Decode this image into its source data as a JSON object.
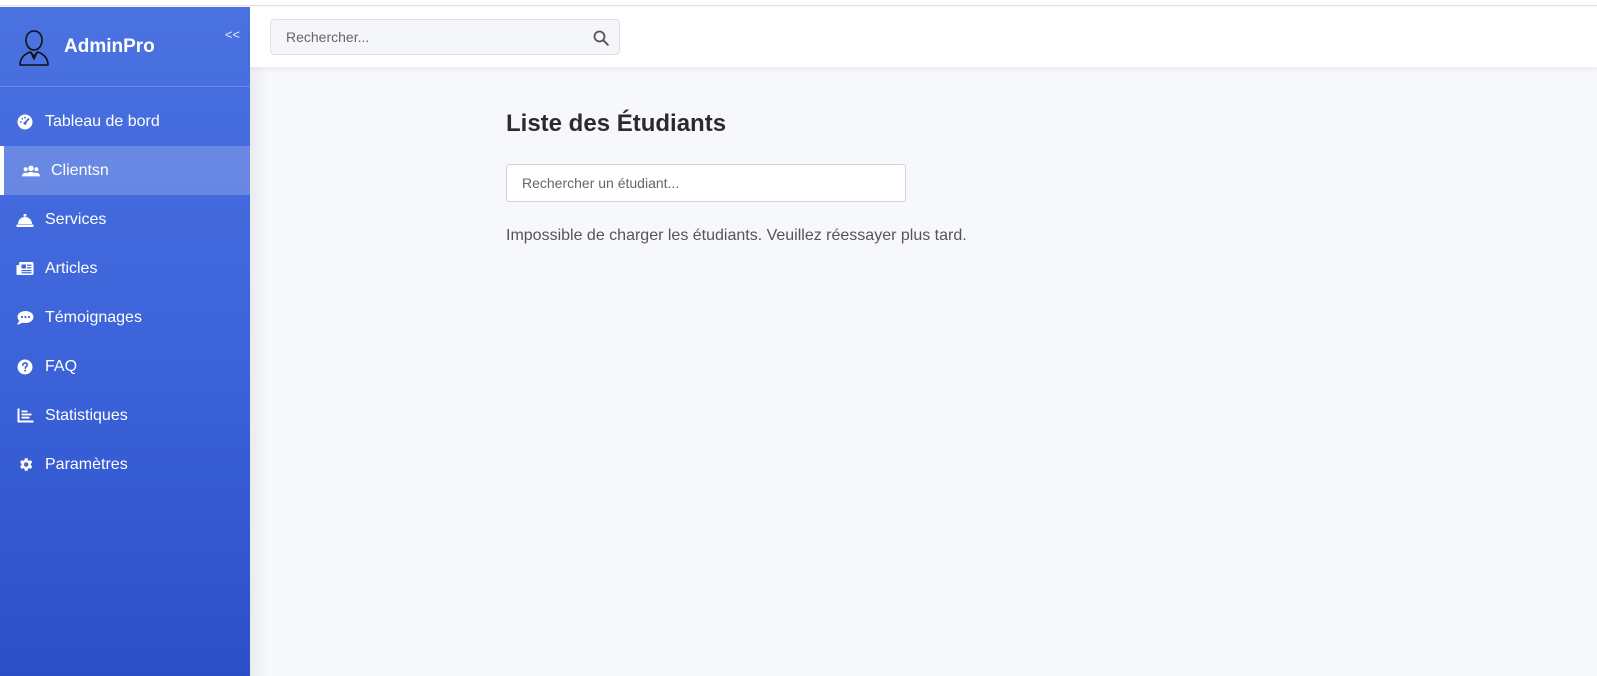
{
  "brand": {
    "name": "AdminPro",
    "collapse_label": "<<"
  },
  "sidebar": {
    "items": [
      {
        "label": "Tableau de bord",
        "icon": "dashboard-icon",
        "active": false
      },
      {
        "label": "Clientsn",
        "icon": "users-icon",
        "active": true
      },
      {
        "label": "Services",
        "icon": "service-bell-icon",
        "active": false
      },
      {
        "label": "Articles",
        "icon": "newspaper-icon",
        "active": false
      },
      {
        "label": "Témoignages",
        "icon": "comment-icon",
        "active": false
      },
      {
        "label": "FAQ",
        "icon": "question-icon",
        "active": false
      },
      {
        "label": "Statistiques",
        "icon": "chart-icon",
        "active": false
      },
      {
        "label": "Paramètres",
        "icon": "gear-icon",
        "active": false
      }
    ]
  },
  "header": {
    "search_placeholder": "Rechercher..."
  },
  "main": {
    "title": "Liste des Étudiants",
    "search_placeholder": "Rechercher un étudiant...",
    "message": "Impossible de charger les étudiants. Veuillez réessayer plus tard."
  },
  "colors": {
    "sidebar_top": "#4b72e0",
    "sidebar_bottom": "#2c4fc8",
    "background": "#f7f8fc"
  }
}
